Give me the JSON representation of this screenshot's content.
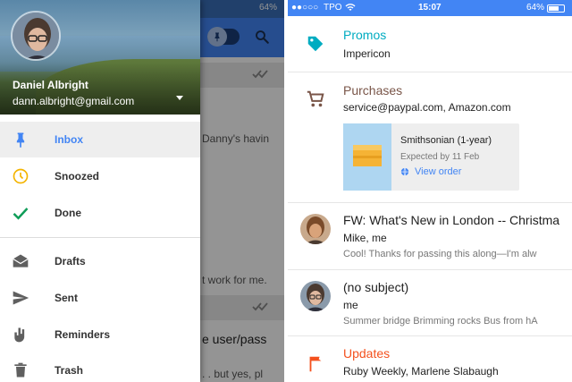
{
  "left": {
    "status": {
      "battery": "64%"
    },
    "background_mail": [
      {
        "text": "Danny's havin",
        "size": "small"
      },
      {
        "text": "t work for me.",
        "size": "small"
      },
      {
        "text": "e user/pass",
        "size": "big"
      },
      {
        "text": ". . but yes, pl",
        "size": "small"
      }
    ],
    "drawer": {
      "user_name": "Daniel Albright",
      "user_email": "dann.albright@gmail.com",
      "items": [
        {
          "label": "Inbox",
          "icon": "pin-icon",
          "active": true,
          "color": "#4285f4"
        },
        {
          "label": "Snoozed",
          "icon": "clock-icon",
          "active": false,
          "color": "#f4b400"
        },
        {
          "label": "Done",
          "icon": "check-icon",
          "active": false,
          "color": "#0f9d58"
        },
        {
          "label": "Drafts",
          "icon": "drafts-icon",
          "active": false,
          "color": "#5f5f5f"
        },
        {
          "label": "Sent",
          "icon": "send-icon",
          "active": false,
          "color": "#5f5f5f"
        },
        {
          "label": "Reminders",
          "icon": "reminder-hand-icon",
          "active": false,
          "color": "#5f5f5f"
        },
        {
          "label": "Trash",
          "icon": "trash-icon",
          "active": false,
          "color": "#5f5f5f"
        }
      ]
    }
  },
  "right": {
    "status": {
      "carrier": "TPO",
      "time": "15:07",
      "battery": "64%"
    },
    "promos": {
      "title": "Promos",
      "sender": "Impericon",
      "color": "#00acc1"
    },
    "purchases": {
      "title": "Purchases",
      "senders": "service@paypal.com, Amazon.com",
      "color": "#795548",
      "card": {
        "title": "Smithsonian (1-year)",
        "expected": "Expected by 11 Feb",
        "link": "View order"
      }
    },
    "emails": [
      {
        "subject": "FW: What's New in London -- Christma",
        "from": "Mike, me",
        "snippet": "Cool! Thanks for passing this along—I'm alw"
      },
      {
        "subject": "(no subject)",
        "from": "me",
        "snippet": "Summer bridge Brimming rocks Bus from hA"
      }
    ],
    "updates": {
      "title": "Updates",
      "senders": "Ruby Weekly, Marlene Slabaugh",
      "color": "#f4511e"
    }
  }
}
